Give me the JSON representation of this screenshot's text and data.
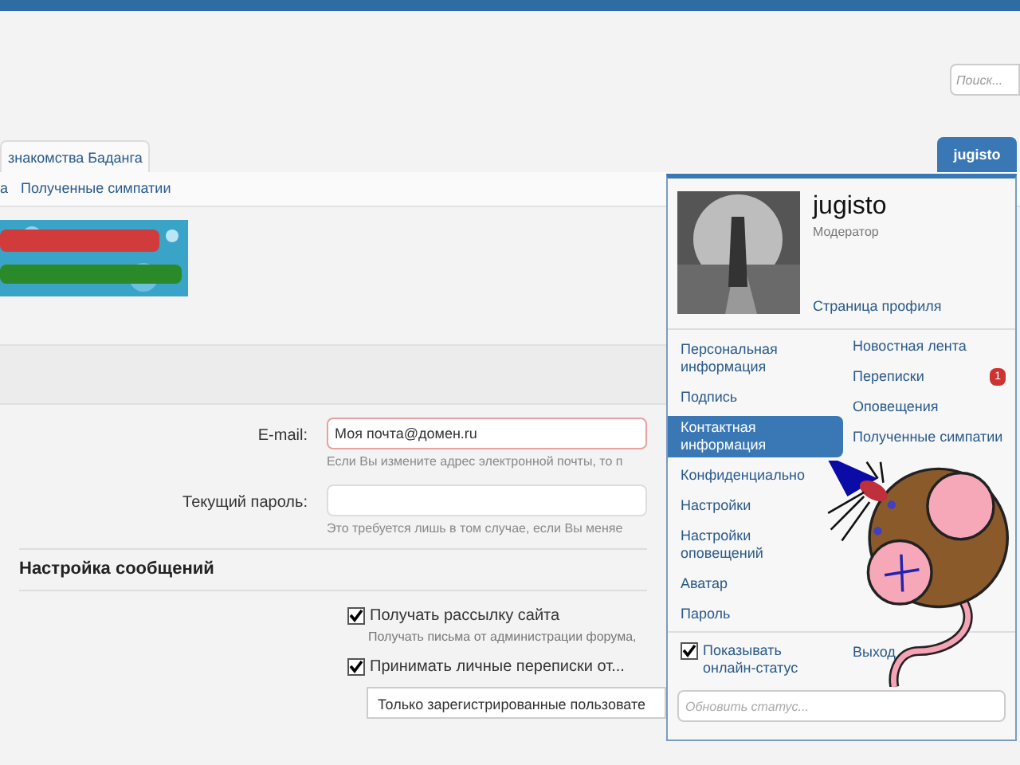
{
  "search": {
    "placeholder": "Поиск..."
  },
  "tabs": [
    {
      "label": "знакомства Баданга",
      "selected": true
    }
  ],
  "user_tab": {
    "label": "jugisto"
  },
  "subnav": [
    {
      "label": "а"
    },
    {
      "label": "Полученные симпатии"
    }
  ],
  "form": {
    "fields": [
      {
        "label": "E-mail:",
        "value": "Моя почта@домен.ru",
        "hint": "Если Вы измените адрес электронной почты, то п",
        "highlighted": true
      },
      {
        "label": "Текущий пароль:",
        "hint": "Это требуется лишь в том случае, если Вы меняе",
        "highlighted": false
      }
    ],
    "section_title": "Настройка сообщений",
    "options": [
      {
        "kind": "checkbox",
        "label": "Получать рассылку сайта",
        "checked": true,
        "hint": "Получать письма от администрации форума,"
      },
      {
        "kind": "checkbox",
        "label": "Принимать личные переписки от...",
        "checked": true
      },
      {
        "kind": "select",
        "value": "Только зарегистрированные пользовате"
      }
    ]
  },
  "menu": {
    "name": "jugisto",
    "role": "Модератор",
    "profile_link": "Страница профиля",
    "left_items": [
      {
        "label": "Персональная информация",
        "selected": false
      },
      {
        "label": "Подпись",
        "selected": false
      },
      {
        "label": "Контактная информация",
        "selected": true
      },
      {
        "label": "Конфиденциально",
        "selected": false
      },
      {
        "label": "Настройки",
        "selected": false
      },
      {
        "label": "Настройки оповещений",
        "selected": false
      },
      {
        "label": "Аватар",
        "selected": false
      },
      {
        "label": "Пароль",
        "selected": false
      }
    ],
    "right_items": [
      {
        "label": "Новостная лента"
      },
      {
        "label": "Переписки",
        "badge": "1"
      },
      {
        "label": "Оповещения"
      },
      {
        "label": "Полученные симпатии"
      }
    ],
    "show_online": {
      "label": "Показывать онлайн-статус",
      "checked": true
    },
    "logout": "Выход",
    "status": {
      "placeholder": "Обновить статус..."
    }
  }
}
